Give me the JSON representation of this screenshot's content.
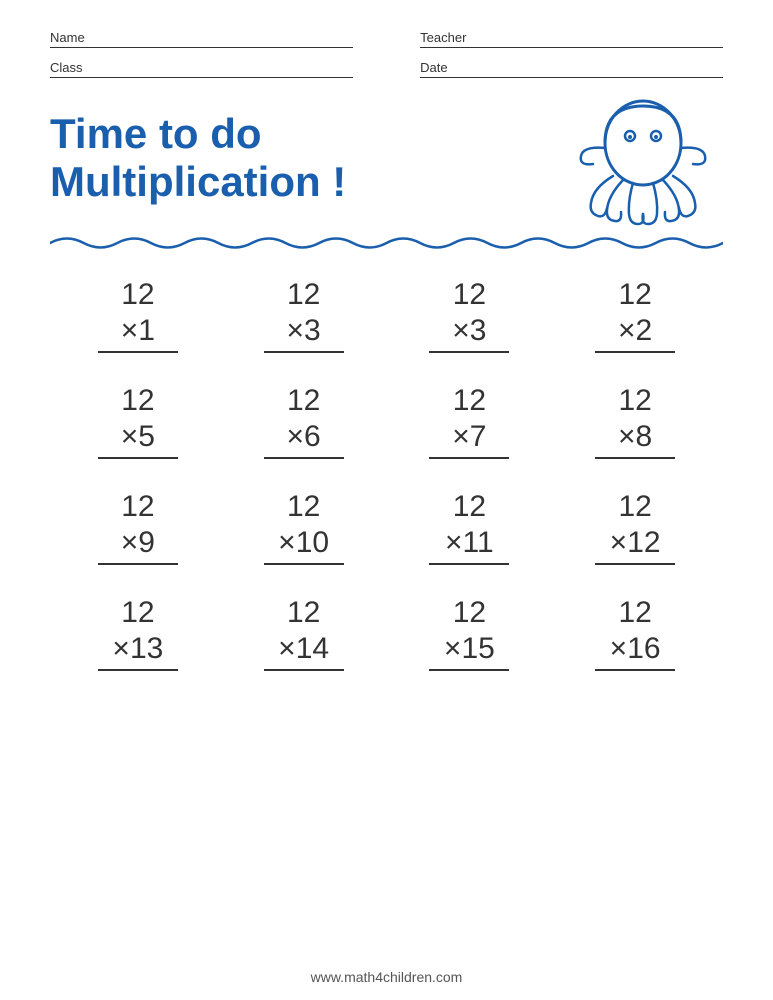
{
  "header": {
    "name_label": "Name",
    "teacher_label": "Teacher",
    "class_label": "Class",
    "date_label": "Date"
  },
  "title": {
    "line1": "Time to do",
    "line2": "Multiplication !"
  },
  "problems": [
    {
      "top": "12",
      "mult": "×1"
    },
    {
      "top": "12",
      "mult": "×3"
    },
    {
      "top": "12",
      "mult": "×3"
    },
    {
      "top": "12",
      "mult": "×2"
    },
    {
      "top": "12",
      "mult": "×5"
    },
    {
      "top": "12",
      "mult": "×6"
    },
    {
      "top": "12",
      "mult": "×7"
    },
    {
      "top": "12",
      "mult": "×8"
    },
    {
      "top": "12",
      "mult": "×9"
    },
    {
      "top": "12",
      "mult": "×10"
    },
    {
      "top": "12",
      "mult": "×11"
    },
    {
      "top": "12",
      "mult": "×12"
    },
    {
      "top": "12",
      "mult": "×13"
    },
    {
      "top": "12",
      "mult": "×14"
    },
    {
      "top": "12",
      "mult": "×15"
    },
    {
      "top": "12",
      "mult": "×16"
    }
  ],
  "footer": {
    "website": "www.math4children.com"
  }
}
